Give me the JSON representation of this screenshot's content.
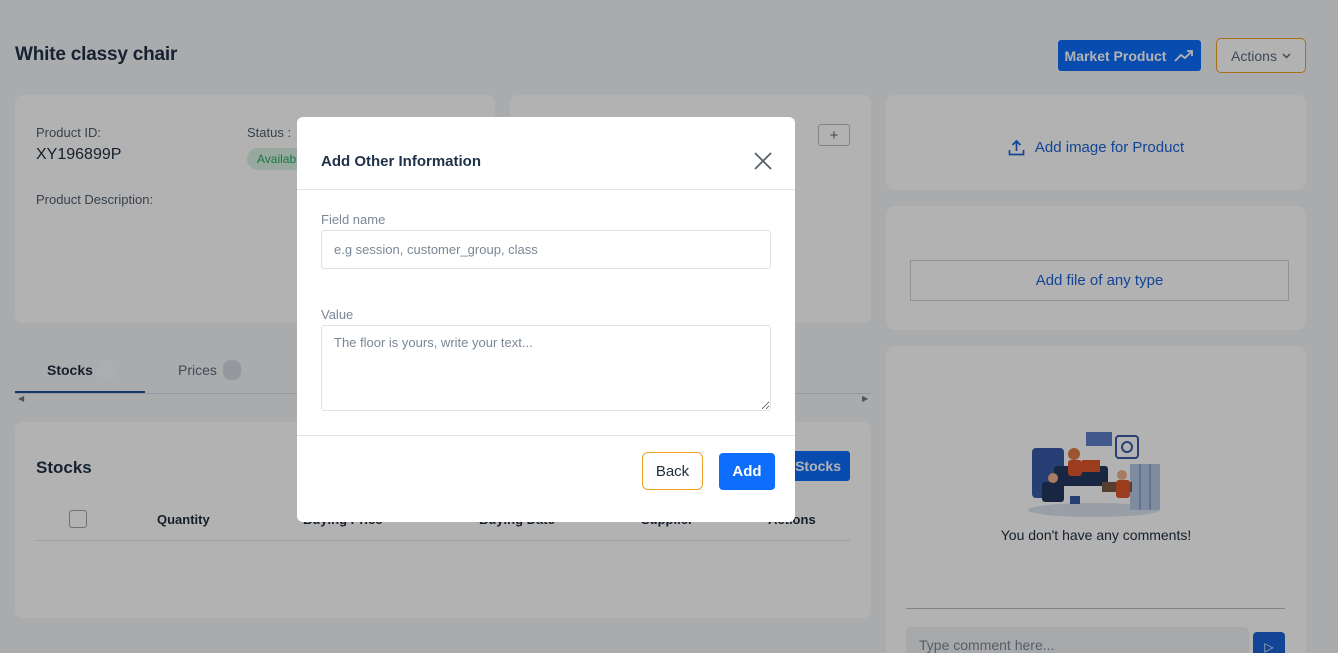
{
  "product": {
    "title": "White classy chair",
    "id_label": "Product ID:",
    "id_value": "XY196899P",
    "status_label": "Status :",
    "status_value": "Availab",
    "description_label": "Product Description:"
  },
  "header": {
    "market_button": "Market Product",
    "actions_button": "Actions"
  },
  "media": {
    "add_image_label": "Add image for Product",
    "add_file_label": "Add file of any type"
  },
  "comments": {
    "empty_text": "You don't have any comments!",
    "input_placeholder": "Type comment here..."
  },
  "tabs": [
    {
      "label": "Stocks",
      "active": true
    },
    {
      "label": "Prices",
      "active": false
    }
  ],
  "stocks": {
    "title": "Stocks",
    "add_button": "d Stocks",
    "columns": [
      "Quantity",
      "Buying Price",
      "Buying Date",
      "Supplier",
      "Actions"
    ]
  },
  "modal": {
    "title": "Add Other Information",
    "field_name_label": "Field name",
    "field_name_placeholder": "e.g session, customer_group, class",
    "value_label": "Value",
    "value_placeholder": "The floor is yours, write your text...",
    "back_button": "Back",
    "add_button": "Add"
  },
  "colors": {
    "primary": "#0d6efd",
    "accent_border": "#f0a020",
    "title": "#1e3148",
    "link": "#1a64d6"
  }
}
